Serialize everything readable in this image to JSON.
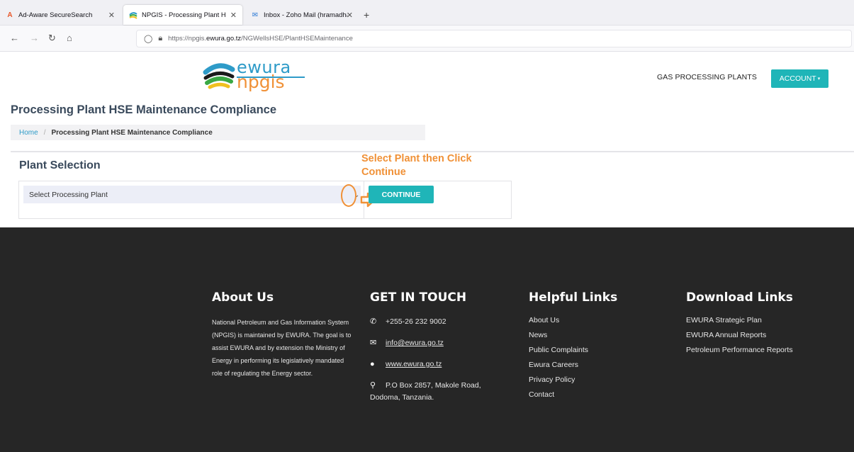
{
  "browser": {
    "tabs": [
      {
        "label": "Ad-Aware SecureSearch",
        "icon": "adaware-icon"
      },
      {
        "label": "NPGIS - Processing Plant HSE M",
        "icon": "npgis-icon"
      },
      {
        "label": "Inbox - Zoho Mail (hramadhani",
        "icon": "mail-icon"
      }
    ],
    "url_prefix": "https://npgis.",
    "url_domain": "ewura.go.tz",
    "url_path": "/NGWellsHSE/PlantHSEMaintenance"
  },
  "header": {
    "logo_top": "ewura",
    "logo_bottom": "npgis",
    "nav_link": "GAS PROCESSING PLANTS",
    "account_label": "ACCOUNT"
  },
  "page": {
    "title": "Processing Plant HSE Maintenance Compliance",
    "breadcrumb_home": "Home",
    "breadcrumb_current": "Processing Plant HSE Maintenance Compliance",
    "section_title": "Plant Selection",
    "annotation": "Select Plant then Click Continue",
    "select_placeholder": "Select Processing Plant",
    "continue_label": "CONTINUE"
  },
  "footer": {
    "about": {
      "heading": "About Us",
      "text": "National Petroleum and Gas Information System (NPGIS) is maintained by EWURA. The goal is to assist EWURA and by extension the Ministry of Energy in performing its legislatively mandated role of regulating the Energy sector."
    },
    "contact": {
      "heading": "GET IN TOUCH",
      "phone": "+255-26 232 9002",
      "email": "info@ewura.go.tz",
      "website": "www.ewura.go.tz",
      "address": "P.O Box 2857, Makole Road, Dodoma, Tanzania."
    },
    "helpful": {
      "heading": "Helpful Links",
      "items": [
        "About Us",
        "News",
        "Public Complaints",
        "Ewura Careers",
        "Privacy Policy",
        "Contact"
      ]
    },
    "downloads": {
      "heading": "Download Links",
      "items": [
        "EWURA Strategic Plan",
        "EWURA Annual Reports",
        "Petroleum Performance Reports"
      ]
    }
  },
  "colors": {
    "accent": "#1fb5b8",
    "annotation": "#f09137",
    "footer_bg": "#262626",
    "link": "#2e9bc8"
  }
}
